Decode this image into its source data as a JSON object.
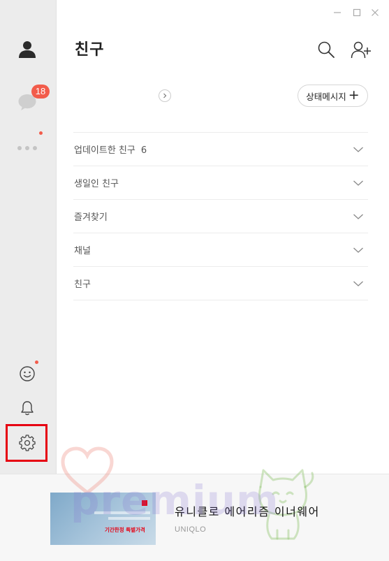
{
  "window": {
    "controls": [
      "minimize",
      "maximize",
      "close"
    ]
  },
  "sidebar": {
    "chat_badge": "18",
    "items": [
      {
        "icon": "person-icon"
      },
      {
        "icon": "chat-icon"
      },
      {
        "icon": "more-icon"
      },
      {
        "icon": "emoticon-icon"
      },
      {
        "icon": "bell-icon"
      },
      {
        "icon": "gear-icon"
      }
    ],
    "notification_color": "#f25c4b",
    "highlight_color": "#e60012"
  },
  "header": {
    "title": "친구"
  },
  "profile": {
    "status_button_label": "상태메시지",
    "status_button_icon": "+"
  },
  "sections": [
    {
      "label": "업데이트한 친구",
      "count": "6"
    },
    {
      "label": "생일인 친구",
      "count": ""
    },
    {
      "label": "즐겨찾기",
      "count": ""
    },
    {
      "label": "채널",
      "count": ""
    },
    {
      "label": "친구",
      "count": ""
    }
  ],
  "ad": {
    "title": "유니클로 에어리즘 이너웨어",
    "brand": "UNIQLO",
    "thumb_text": "기간한정 특별가격"
  },
  "watermark": {
    "text": "premium"
  }
}
